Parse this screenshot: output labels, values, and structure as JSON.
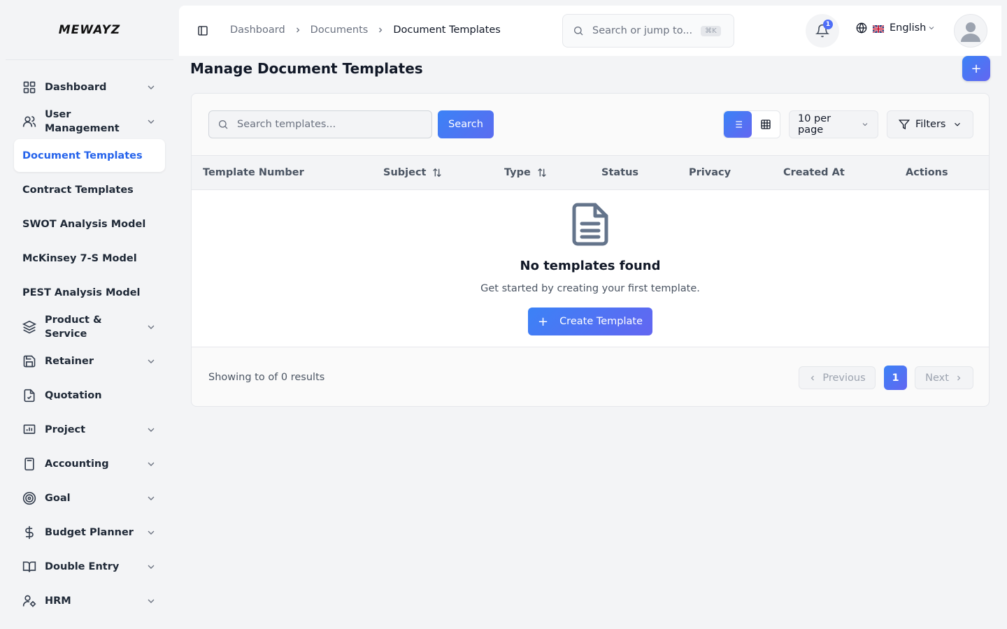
{
  "brand": {
    "logo_text": "MEWAYZ"
  },
  "sidebar": {
    "items": [
      {
        "label": "Dashboard",
        "icon": "grid-icon",
        "expandable": true
      },
      {
        "label": "User Management",
        "icon": "users-icon",
        "expandable": true
      },
      {
        "label": "Document Templates",
        "active": true
      },
      {
        "label": "Contract Templates"
      },
      {
        "label": "SWOT Analysis Model"
      },
      {
        "label": "McKinsey 7-S Model"
      },
      {
        "label": "PEST Analysis Model"
      },
      {
        "label": "Product & Service",
        "icon": "layers-icon",
        "expandable": true
      },
      {
        "label": "Retainer",
        "icon": "save-icon",
        "expandable": true
      },
      {
        "label": "Quotation",
        "icon": "file-check-icon",
        "expandable": false
      },
      {
        "label": "Project",
        "icon": "presentation-icon",
        "expandable": true
      },
      {
        "label": "Accounting",
        "icon": "calculator-icon",
        "expandable": true
      },
      {
        "label": "Goal",
        "icon": "target-icon",
        "expandable": true
      },
      {
        "label": "Budget Planner",
        "icon": "dollar-icon",
        "expandable": true
      },
      {
        "label": "Double Entry",
        "icon": "book-icon",
        "expandable": true
      },
      {
        "label": "HRM",
        "icon": "user-cog-icon",
        "expandable": true
      }
    ]
  },
  "topbar": {
    "breadcrumbs": [
      "Dashboard",
      "Documents",
      "Document Templates"
    ],
    "search_placeholder": "Search or jump to...",
    "search_shortcut": "⌘K",
    "notification_count": "1",
    "language": "English"
  },
  "page": {
    "title": "Manage Document Templates",
    "add_label": "+"
  },
  "toolbar": {
    "search_placeholder": "Search templates...",
    "search_button": "Search",
    "per_page": "10 per page",
    "filters": "Filters"
  },
  "table": {
    "columns": [
      "Template Number",
      "Subject",
      "Type",
      "Status",
      "Privacy",
      "Created At",
      "Actions"
    ],
    "rows": []
  },
  "empty_state": {
    "title": "No templates found",
    "subtitle": "Get started by creating your first template.",
    "button": "Create Template"
  },
  "pagination": {
    "summary": "Showing to of 0 results",
    "previous": "Previous",
    "current_page": "1",
    "next": "Next"
  },
  "colors": {
    "accent": "#3b82f6",
    "accent_end": "#6366f1",
    "active_nav_text": "#2563eb"
  }
}
